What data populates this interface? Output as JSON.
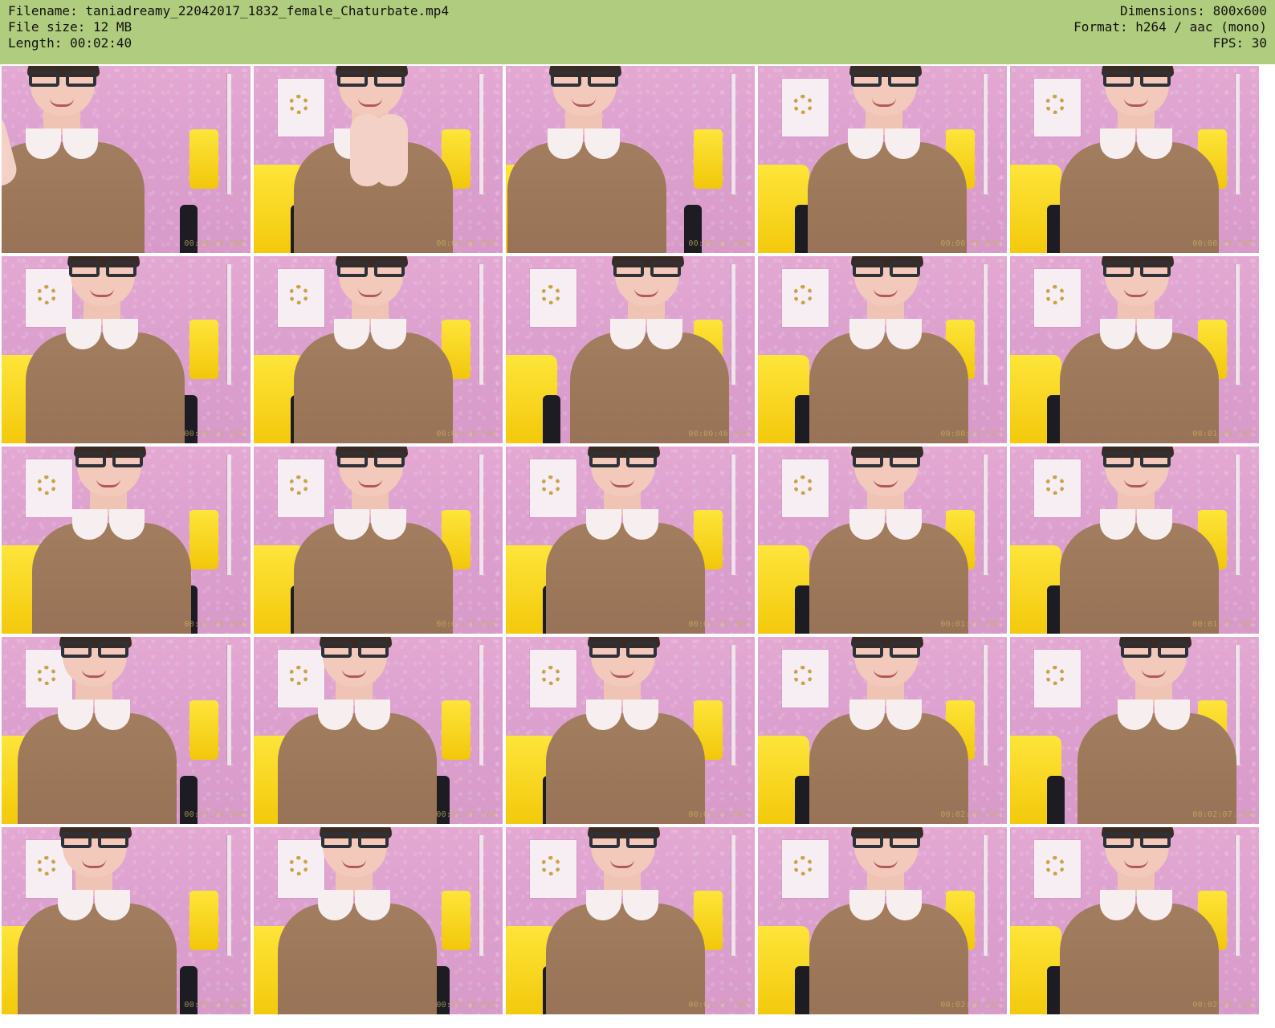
{
  "header": {
    "filename": "Filename: taniadreamy_22042017_1832_female_Chaturbate.mp4",
    "file_size": "File size: 12 MB",
    "length": "Length: 00:02:40",
    "dimensions": "Dimensions: 800x600",
    "format": "Format: h264 / aac (mono)",
    "fps": "FPS: 30"
  },
  "colors": {
    "header_bg": "#b0cc7e",
    "wall_pink": "#dda1cf",
    "sofa_yellow": "#f7d21d",
    "sweater_brown": "#9c7658"
  },
  "thumbnails": [
    {
      "timestamp": "00:00:00.000"
    },
    {
      "timestamp": "00:00:06.667"
    },
    {
      "timestamp": "00:00:13.282"
    },
    {
      "timestamp": "00:00:20.000"
    },
    {
      "timestamp": "00:00:26.788"
    },
    {
      "timestamp": "00:00:33.433"
    },
    {
      "timestamp": "00:00:40.100"
    },
    {
      "timestamp": "00:00:46.976"
    },
    {
      "timestamp": "00:00:53.673"
    },
    {
      "timestamp": "00:01:00.288"
    },
    {
      "timestamp": "00:01:06.966"
    },
    {
      "timestamp": "00:01:13.662"
    },
    {
      "timestamp": "00:01:20.360"
    },
    {
      "timestamp": "00:01:27.066"
    },
    {
      "timestamp": "00:01:33.762"
    },
    {
      "timestamp": "00:01:40.449"
    },
    {
      "timestamp": "00:01:47.144"
    },
    {
      "timestamp": "00:01:53.842"
    },
    {
      "timestamp": "00:02:00.528"
    },
    {
      "timestamp": "00:02:07.236"
    },
    {
      "timestamp": "00:02:13.932"
    },
    {
      "timestamp": "00:02:20.620"
    },
    {
      "timestamp": "00:02:27.326"
    },
    {
      "timestamp": "00:02:34.022"
    },
    {
      "timestamp": "00:02:40.710"
    }
  ]
}
